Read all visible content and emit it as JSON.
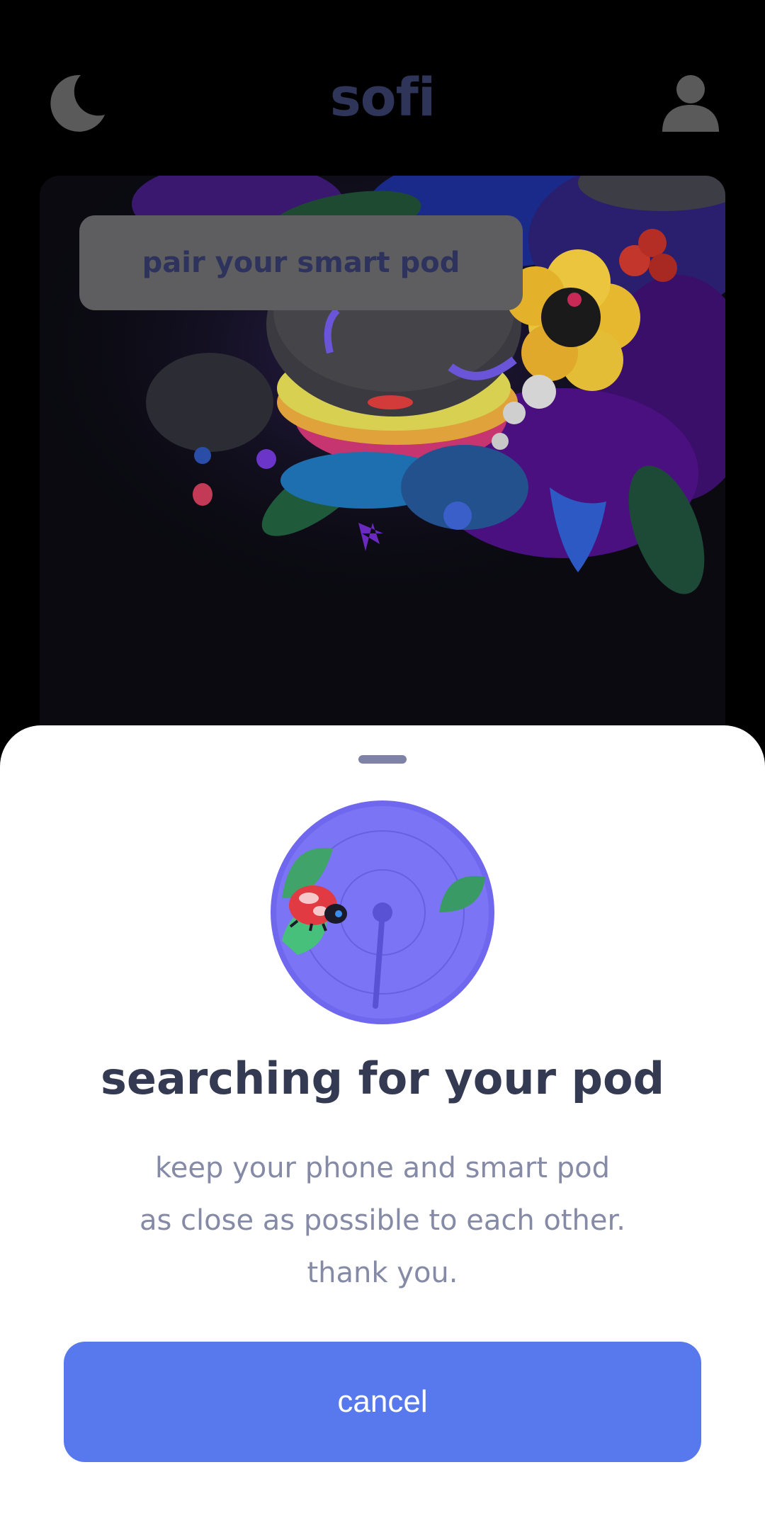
{
  "header": {
    "logo_text": "sofi",
    "left_icon": "moon-icon",
    "right_icon": "profile-icon"
  },
  "hero": {
    "pair_button_label": "pair your smart pod"
  },
  "sheet": {
    "illustration": "radar-search-icon",
    "title": "searching for your pod",
    "description_lines": [
      "keep your phone and smart pod",
      "as close as possible to each other.",
      "thank you."
    ],
    "cancel_label": "cancel"
  },
  "colors": {
    "accent": "#5879ed",
    "radar": "#7b74f4",
    "title": "#343a52",
    "body_text": "#858aa6",
    "logo": "#2f3459"
  }
}
